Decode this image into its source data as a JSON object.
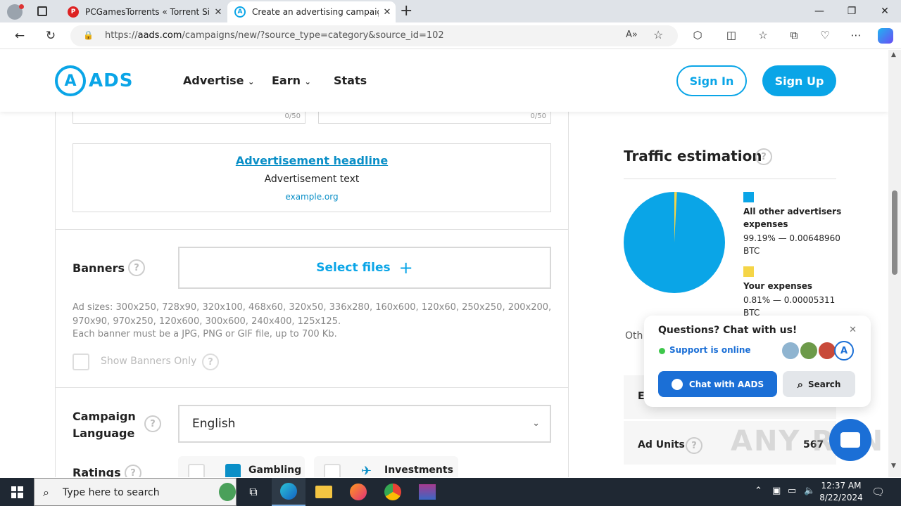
{
  "browser": {
    "tabs": [
      {
        "title": "PCGamesTorrents « Torrent Site f",
        "active": false
      },
      {
        "title": "Create an advertising campaign |",
        "active": true
      }
    ],
    "new_tab": "+",
    "url_prefix": "https://",
    "url_domain": "aads.com",
    "url_path": "/campaigns/new/?source_type=category&source_id=102"
  },
  "site": {
    "logo_letter": "A",
    "logo_word": "ADS",
    "nav": [
      {
        "label": "Advertise",
        "has_menu": true
      },
      {
        "label": "Earn",
        "has_menu": true
      },
      {
        "label": "Stats",
        "has_menu": false
      }
    ],
    "sign_in": "Sign In",
    "sign_up": "Sign Up"
  },
  "form": {
    "counter_left": "0/50",
    "counter_right": "0/50",
    "preview": {
      "headline": "Advertisement headline",
      "text": "Advertisement text",
      "domain": "example.org"
    },
    "banners_label": "Banners",
    "select_files": "Select files",
    "ad_sizes": "Ad sizes: 300x250, 728x90, 320x100, 468x60, 320x50, 336x280, 160x600, 120x60, 250x250, 200x200, 970x90, 970x250, 120x600, 300x600, 240x400, 125x125.",
    "banner_note": "Each banner must be a JPG, PNG or GIF file, up to 700 Kb.",
    "show_banners_only": "Show Banners Only",
    "campaign_language_label_1": "Campaign",
    "campaign_language_label_2": "Language",
    "language_value": "English",
    "ratings_label": "Ratings",
    "rating_gambling": "Gambling",
    "rating_investments": "Investments"
  },
  "traffic": {
    "title": "Traffic estimation",
    "others_color": "#0aa5e7",
    "yours_color": "#f5d547",
    "others_name": "All other advertisers expenses",
    "others_value": "99.19% — 0.00648960 BTC",
    "others_share": 0.9919,
    "yours_name": "Your expenses",
    "yours_value": "0.81% — 0.00005311 BTC",
    "yours_share": 0.0081,
    "partial_label": "Oth",
    "row_partial": "E",
    "ad_units_label": "Ad Units",
    "ad_units_value": "567"
  },
  "chat": {
    "question": "Questions? Chat with us!",
    "status": "Support is online",
    "chat_button": "Chat with AADS",
    "search_button": "Search"
  },
  "watermark": "ANY RUN",
  "taskbar": {
    "search_placeholder": "Type here to search",
    "time": "12:37 AM",
    "date": "8/22/2024"
  }
}
